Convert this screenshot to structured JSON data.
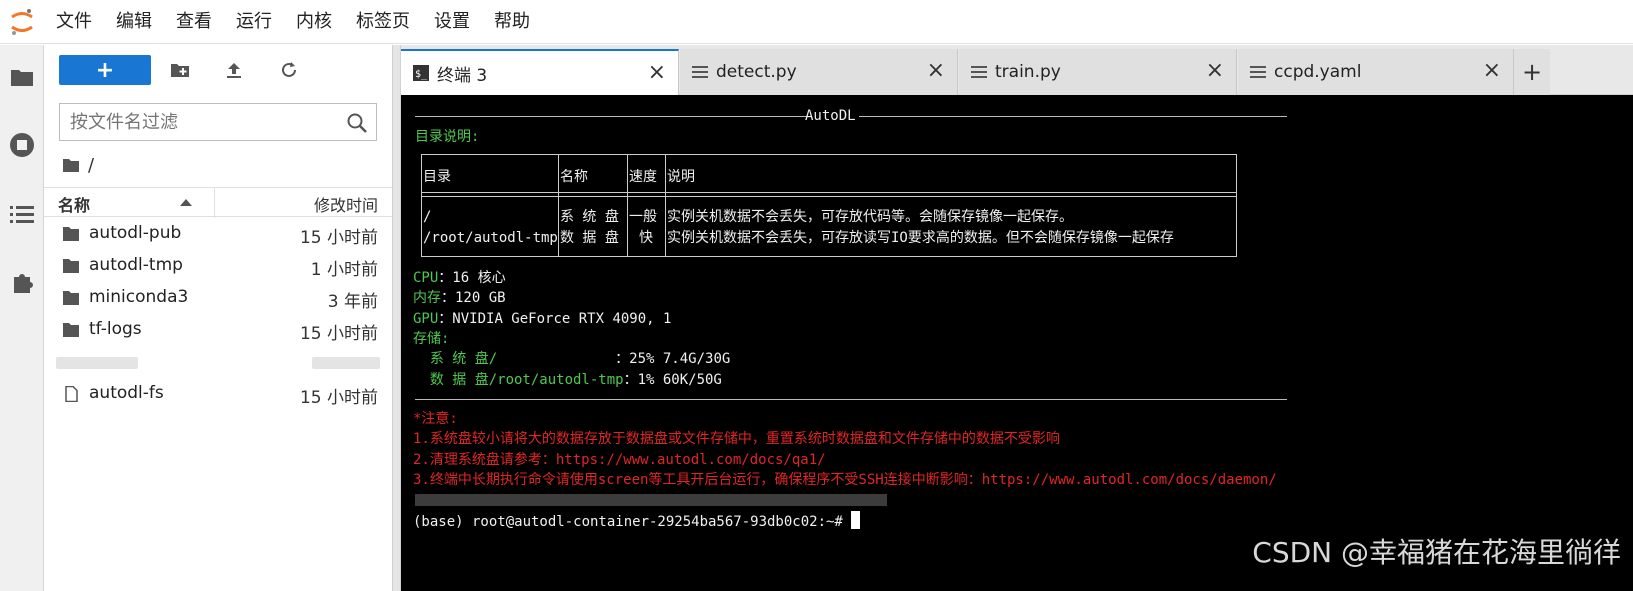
{
  "menu": [
    "文件",
    "编辑",
    "查看",
    "运行",
    "内核",
    "标签页",
    "设置",
    "帮助"
  ],
  "toolbar": {
    "new_label": "+"
  },
  "filter": {
    "placeholder": "按文件名过滤"
  },
  "breadcrumb": "/",
  "columns": {
    "name": "名称",
    "modified": "修改时间"
  },
  "files": [
    {
      "name": "autodl-pub",
      "time": "15 小时前",
      "icon": "folder-icon"
    },
    {
      "name": "autodl-tmp",
      "time": "1 小时前",
      "icon": "folder-icon"
    },
    {
      "name": "miniconda3",
      "time": "3 年前",
      "icon": "folder-icon"
    },
    {
      "name": "tf-logs",
      "time": "15 小时前",
      "icon": "folder-icon"
    },
    {
      "name": "",
      "time": "",
      "icon": "redacted"
    },
    {
      "name": "autodl-fs",
      "time": "15 小时前",
      "icon": "file-icon"
    }
  ],
  "tabs": [
    {
      "label": "终端 3",
      "icon": "terminal-icon",
      "active": true
    },
    {
      "label": "detect.py",
      "icon": "text-file-icon",
      "active": false
    },
    {
      "label": "train.py",
      "icon": "text-file-icon",
      "active": false
    },
    {
      "label": "ccpd.yaml",
      "icon": "text-file-icon",
      "active": false
    }
  ],
  "tab_close": "×",
  "tab_add": "+",
  "terminal": {
    "banner": "AutoDL",
    "dir_title": "目录说明:",
    "table_headers": [
      "目录",
      "名称",
      "速度",
      "说明"
    ],
    "table_rows": [
      [
        "/",
        "系 统 盘",
        "一般",
        "实例关机数据不会丢失，可存放代码等。会随保存镜像一起保存。"
      ],
      [
        "/root/autodl-tmp",
        "数 据 盘",
        "快",
        "实例关机数据不会丢失，可存放读写IO要求高的数据。但不会随保存镜像一起保存"
      ]
    ],
    "cpu_label": "CPU",
    "cpu_value": "：16 核心",
    "mem_label": "内存",
    "mem_value": "：120 GB",
    "gpu_label": "GPU",
    "gpu_value": "：NVIDIA GeForce RTX 4090, 1",
    "storage_label": "存储:",
    "sys_disk_label": "  系 统 盘/              ",
    "sys_disk_value": "：25% 7.4G/30G",
    "data_disk_label": "  数 据 盘/root/autodl-tmp",
    "data_disk_value": "：1% 60K/50G",
    "notice_title": "*注意:",
    "notices": [
      "1.系统盘较小请将大的数据存放于数据盘或文件存储中，重置系统时数据盘和文件存储中的数据不受影响",
      "2.清理系统盘请参考：https://www.autodl.com/docs/qa1/",
      "3.终端中长期执行命令请使用screen等工具开后台运行，确保程序不受SSH连接中断影响：https://www.autodl.com/docs/daemon/"
    ],
    "prompt": "(base) root@autodl-container-29254ba567-93db0c02:~# "
  },
  "watermark": "CSDN @幸福猪在花海里徜徉",
  "colors": {
    "accent": "#1976d2",
    "terminal_bg": "#000000",
    "green": "#4ec94e",
    "red": "#e02525"
  }
}
